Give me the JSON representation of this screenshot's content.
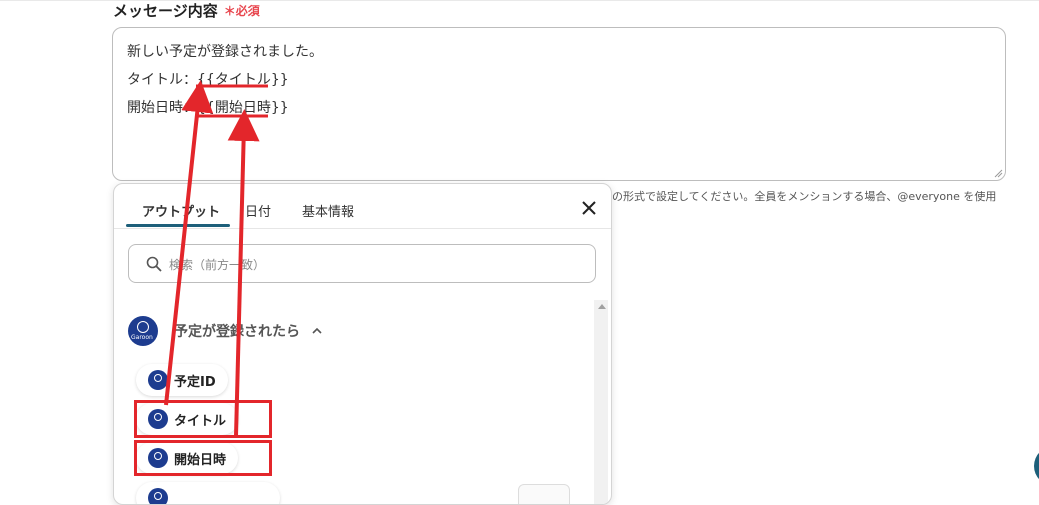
{
  "field": {
    "label": "メッセージ内容",
    "required_mark": "＊",
    "required_text": "必須"
  },
  "message": {
    "line1": "新しい予定が登録されました。",
    "line2": "タイトル：{{タイトル}}",
    "line3": "開始日時：{{開始日時}}"
  },
  "helper_text": "の形式で設定してください。全員をメンションする場合、@everyone を使用",
  "panel": {
    "tabs": [
      {
        "label": "アウトプット"
      },
      {
        "label": "日付"
      },
      {
        "label": "基本情報"
      }
    ],
    "search_placeholder": "検索（前方一致）",
    "group": {
      "title": "予定が登録されたら",
      "logo_text": "Garoon"
    },
    "items": [
      {
        "label": "予定ID"
      },
      {
        "label": "タイトル"
      },
      {
        "label": "開始日時"
      },
      {
        "label": ""
      }
    ]
  },
  "colors": {
    "accent": "#1d5f7a",
    "required": "#e8474f",
    "annotation": "#e3262b",
    "app_logo": "#1d3c8f"
  }
}
